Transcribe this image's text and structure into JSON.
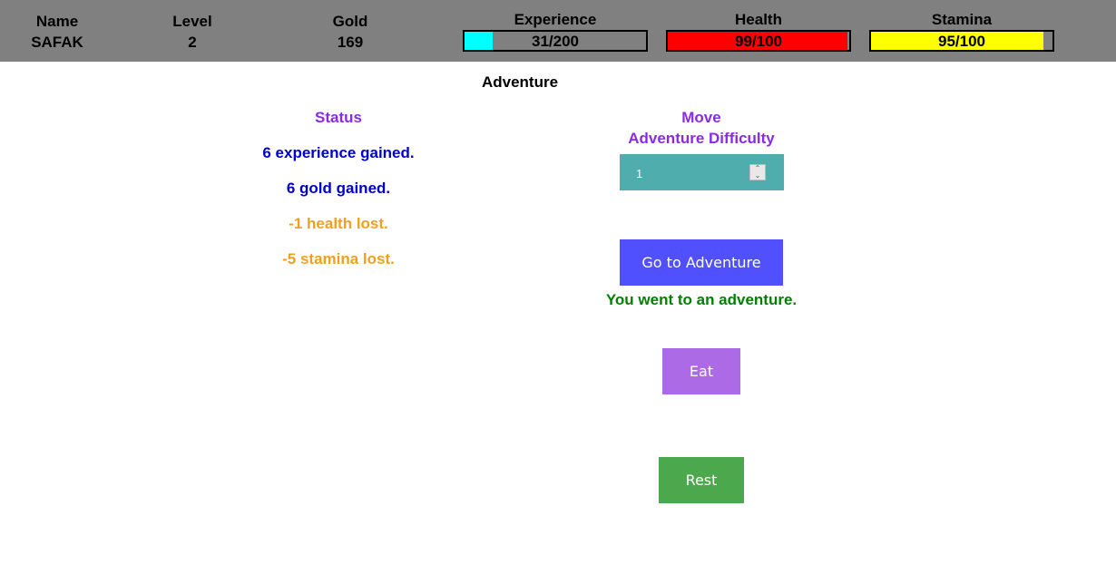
{
  "header": {
    "name_label": "Name",
    "name_value": "SAFAK",
    "level_label": "Level",
    "level_value": "2",
    "gold_label": "Gold",
    "gold_value": "169",
    "experience": {
      "label": "Experience",
      "text": "31/200",
      "current": 31,
      "max": 200,
      "color": "#00ffff"
    },
    "health": {
      "label": "Health",
      "text": "99/100",
      "current": 99,
      "max": 100,
      "color": "#ff0000"
    },
    "stamina": {
      "label": "Stamina",
      "text": "95/100",
      "current": 95,
      "max": 100,
      "color": "#ffff00"
    }
  },
  "page_title": "Adventure",
  "status": {
    "heading": "Status",
    "lines": [
      "6 experience gained.",
      "6 gold gained.",
      "-1 health lost.",
      "-5 stamina lost."
    ]
  },
  "move": {
    "heading": "Move",
    "difficulty_label": "Adventure Difficulty",
    "difficulty_value": "1",
    "adventure_button": "Go to Adventure",
    "message": "You went to an adventure.",
    "eat_button": "Eat",
    "rest_button": "Rest"
  },
  "colors": {
    "header_bg": "#808080",
    "adventure_btn": "#5050ff",
    "eat_btn": "#ad6ae6",
    "rest_btn": "#4ca84c",
    "input_bg": "#4fadad"
  }
}
